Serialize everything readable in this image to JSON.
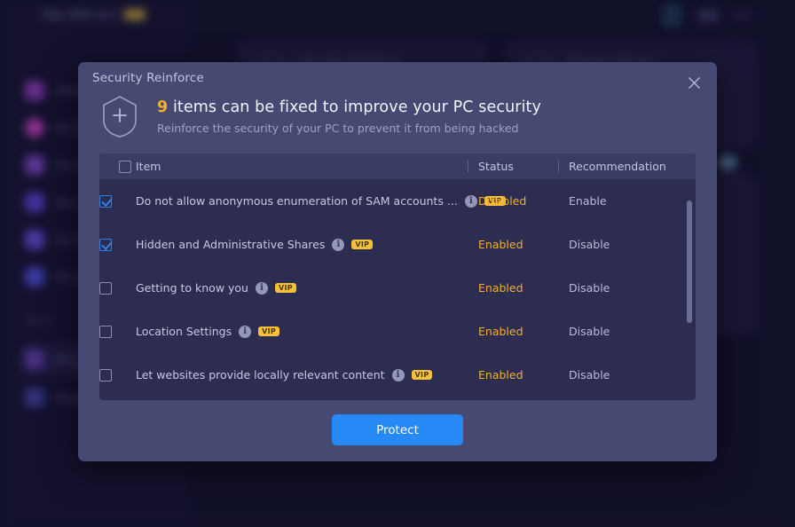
{
  "background_app": {
    "title": "iTop VPN v4.1",
    "pro_badge": "PRO",
    "nav_items": [
      {
        "label": "Home",
        "icon": "home-icon"
      },
      {
        "label": "All Servers",
        "icon": "globe-icon"
      },
      {
        "label": "For Downloading",
        "icon": "download-icon"
      },
      {
        "label": "For Streaming",
        "icon": "video-icon"
      },
      {
        "label": "For Social",
        "icon": "social-icon"
      },
      {
        "label": "For Gaming",
        "icon": "gamepad-icon"
      }
    ],
    "section_label": "Tools",
    "tool_items": [
      {
        "label": "Privacy",
        "icon": "privacy-icon"
      },
      {
        "label": "Quick",
        "icon": "link-icon"
      }
    ],
    "top_icons": [
      "device-icon",
      "menu-icon",
      "more-icon"
    ],
    "cards": [
      {
        "title": "Security Reinforce"
      },
      {
        "title": "Browser Privacy"
      }
    ]
  },
  "dialog": {
    "title": "Security Reinforce",
    "close_label": "✕",
    "shield_icon": "shield-plus-icon",
    "headline_count": "9",
    "headline_text": " items can be fixed to improve your PC security",
    "subtitle": "Reinforce the security of your PC to prevent it from being hacked",
    "table": {
      "columns": [
        "Item",
        "Status",
        "Recommendation"
      ],
      "header_checkbox_checked": false,
      "rows": [
        {
          "checked": true,
          "name": "Do not allow anonymous enumeration of SAM accounts ...",
          "info": "i",
          "vip": "VIP",
          "status": "Disabled",
          "recommendation": "Enable"
        },
        {
          "checked": true,
          "name": "Hidden and Administrative Shares",
          "info": "i",
          "vip": "VIP",
          "status": "Enabled",
          "recommendation": "Disable"
        },
        {
          "checked": false,
          "name": "Getting to know you",
          "info": "i",
          "vip": "VIP",
          "status": "Enabled",
          "recommendation": "Disable"
        },
        {
          "checked": false,
          "name": "Location Settings",
          "info": "i",
          "vip": "VIP",
          "status": "Enabled",
          "recommendation": "Disable"
        },
        {
          "checked": false,
          "name": "Let websites provide locally relevant content",
          "info": "i",
          "vip": "VIP",
          "status": "Enabled",
          "recommendation": "Disable"
        }
      ]
    },
    "protect_button": "Protect"
  },
  "colors": {
    "dialog_bg": "#464a72",
    "table_bg": "#2d2d52",
    "table_header_bg": "#393c63",
    "accent_blue": "#2689f5",
    "status_amber": "#f1b02b",
    "vip_gold": "#f5c13d",
    "count_gold": "#f2b22c"
  }
}
